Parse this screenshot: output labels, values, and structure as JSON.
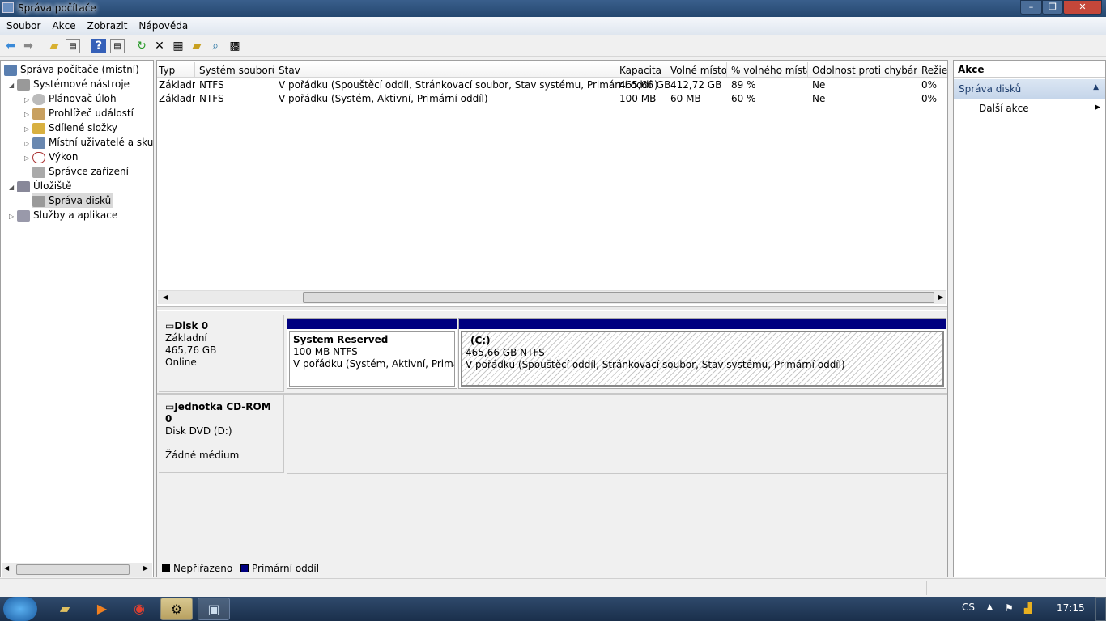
{
  "window": {
    "title": "Správa počítače",
    "minimize": "–",
    "maximize": "❐",
    "close": "✕"
  },
  "menu": [
    "Soubor",
    "Akce",
    "Zobrazit",
    "Nápověda"
  ],
  "toolbar": {
    "icons": [
      "back-arrow-icon",
      "forward-arrow-icon",
      "up-folder-icon",
      "show-hide-tree-icon",
      "help-icon",
      "show-hide-action-pane-icon",
      "refresh-icon",
      "delete-icon",
      "properties-icon",
      "open-icon",
      "search-icon",
      "settings-icon"
    ]
  },
  "tree": {
    "root": "Správa počítače (místní)",
    "system_tools": "Systémové nástroje",
    "items": [
      "Plánovač úloh",
      "Prohlížeč událostí",
      "Sdílené složky",
      "Místní uživatelé a skupiny",
      "Výkon",
      "Správce zařízení"
    ],
    "storage": "Úložiště",
    "disk_management": "Správa disků",
    "services": "Služby a aplikace"
  },
  "table": {
    "columns": [
      "Typ",
      "Systém souborů",
      "Stav",
      "Kapacita",
      "Volné místo",
      "% volného místa",
      "Odolnost proti chybám",
      "Režie"
    ],
    "rows": [
      [
        "Základní",
        "NTFS",
        "V pořádku (Spouštěcí oddíl, Stránkovací soubor, Stav systému, Primární oddíl)",
        "465,66 GB",
        "412,72 GB",
        "89 %",
        "Ne",
        "0%"
      ],
      [
        "Základní",
        "NTFS",
        "V pořádku (Systém, Aktivní, Primární oddíl)",
        "100 MB",
        "60 MB",
        "60 %",
        "Ne",
        "0%"
      ]
    ]
  },
  "disks": [
    {
      "name": "Disk 0",
      "type": "Základní",
      "size": "465,76 GB",
      "status": "Online",
      "partitions": [
        {
          "name": "System Reserved",
          "size": "100 MB NTFS",
          "status": "V pořádku (Systém, Aktivní, Primární oddíl)"
        },
        {
          "name": "(C:)",
          "size": "465,66 GB NTFS",
          "status": "V pořádku (Spouštěcí oddíl, Stránkovací soubor, Stav systému, Primární oddíl)"
        }
      ]
    },
    {
      "name": "Jednotka CD-ROM 0",
      "type": "Disk DVD (D:)",
      "status": "Žádné médium"
    }
  ],
  "legend": [
    {
      "label": "Nepřiřazeno",
      "color": "#000000"
    },
    {
      "label": "Primární oddíl",
      "color": "#000080"
    }
  ],
  "actions": {
    "header": "Akce",
    "section": "Správa disků",
    "more": "Další akce"
  },
  "taskbar": {
    "lang": "CS",
    "time": "17:15"
  }
}
